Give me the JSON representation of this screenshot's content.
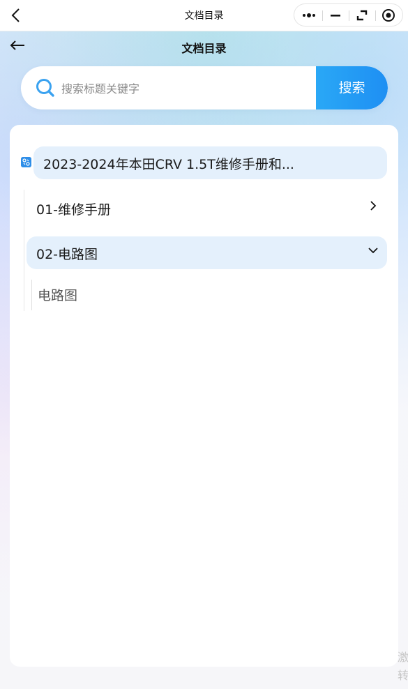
{
  "topbar": {
    "title": "文档目录",
    "icons": [
      "back-chevron-icon",
      "more-dots-icon",
      "minimize-icon",
      "restore-icon",
      "close-circle-icon"
    ]
  },
  "header": {
    "title": "文档目录",
    "back_icon": "arrow-left-icon"
  },
  "search": {
    "placeholder": "搜索标题关键字",
    "value": "",
    "button_label": "搜索",
    "accent": "#1e8ff3"
  },
  "tree": {
    "root_label": "2023-2024年本田CRV 1.5T维修手册和...",
    "children": [
      {
        "label": "01-维修手册",
        "expanded": false
      },
      {
        "label": "02-电路图",
        "expanded": true,
        "children": [
          {
            "label": "电路图"
          }
        ]
      }
    ]
  },
  "watermark": "激转"
}
